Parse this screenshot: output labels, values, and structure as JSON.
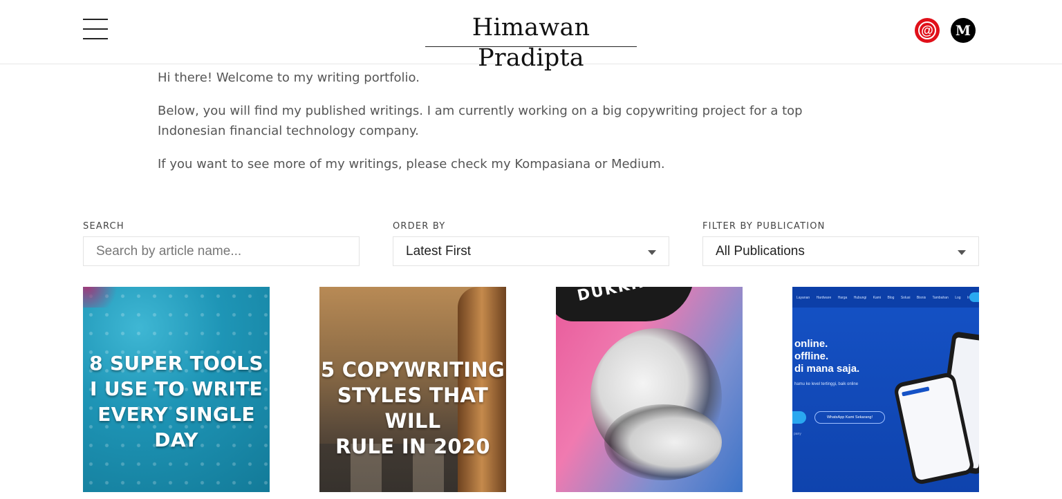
{
  "header": {
    "title": "Himawan Pradipta",
    "menu_icon": "hamburger-menu-icon",
    "social": {
      "kompasiana_icon": "at-sign-icon",
      "kompasiana_glyph": "@",
      "medium_icon": "medium-logo-icon",
      "medium_glyph": "M",
      "kompasiana_color": "#e0101a",
      "medium_color": "#000000"
    }
  },
  "intro": {
    "p1": "Hi there! Welcome to my writing portfolio.",
    "p2": "Below, you will find my published writings. I am currently working on a big copywriting project for a top Indonesian financial technology company.",
    "p3": "If you want to see more of my writings, please check my Kompasiana or Medium."
  },
  "filters": {
    "search_label": "SEARCH",
    "search_placeholder": "Search by article name...",
    "order_label": "ORDER BY",
    "order_value": "Latest First",
    "publication_label": "FILTER BY PUBLICATION",
    "publication_value": "All Publications"
  },
  "cards": [
    {
      "lines": [
        "8 SUPER TOOLS",
        "I USE TO WRITE",
        "EVERY SINGLE DAY"
      ]
    },
    {
      "lines": [
        "5 COPYWRITING",
        "STYLES THAT WILL",
        "RULE IN 2020"
      ]
    },
    {
      "bubble_text": "DUKKHA."
    },
    {
      "nav": "Layanan  Hardware  Harga  Hubungi Kami  Blog  Solusi Bisnis  Tambahan  Log In",
      "hero": [
        "online.",
        "offline.",
        "di mana saja."
      ],
      "sub": "hamu ke level tertinggi, baik online",
      "button": "WhatsApp Kami Sekarang!",
      "small": "pany"
    }
  ]
}
